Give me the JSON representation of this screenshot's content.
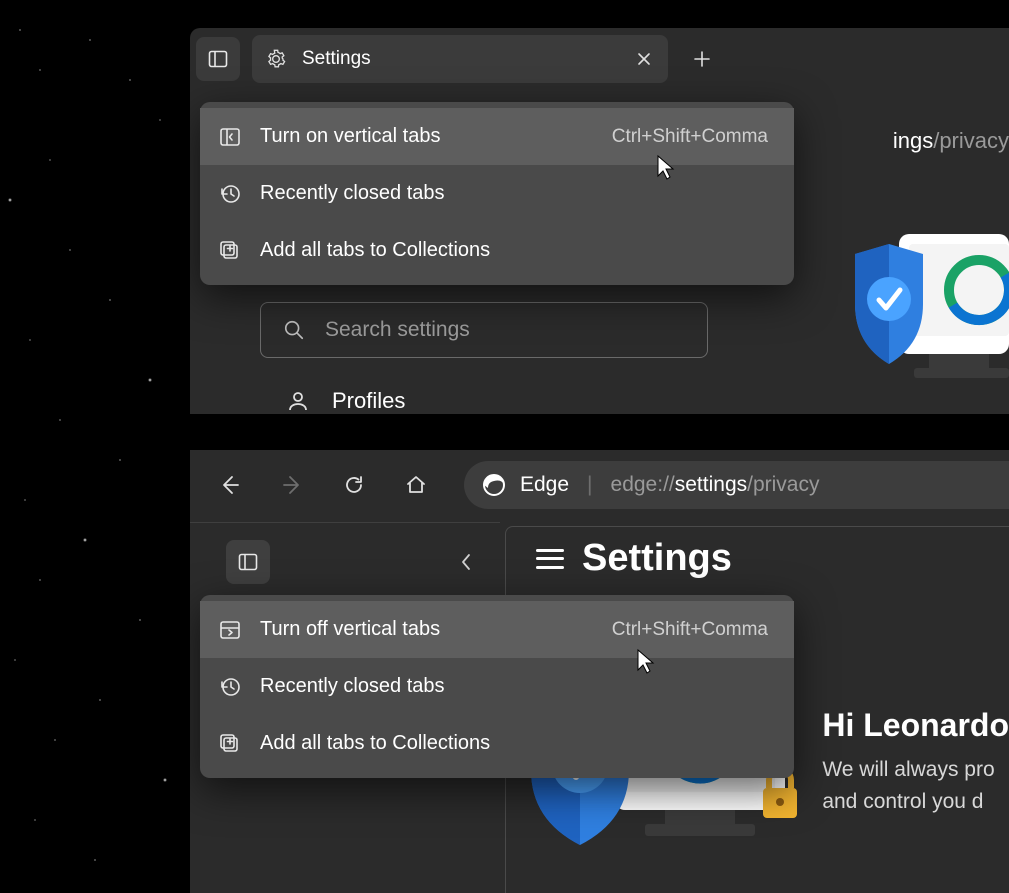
{
  "top": {
    "tab_title": "Settings",
    "url_part1": "ings",
    "url_part2": "/privacy",
    "menu": {
      "item1_label": "Turn on vertical tabs",
      "item1_shortcut": "Ctrl+Shift+Comma",
      "item2_label": "Recently closed tabs",
      "item3_label": "Add all tabs to Collections"
    },
    "search_placeholder": "Search settings",
    "profiles_label": "Profiles"
  },
  "bottom": {
    "addr_brand": "Edge",
    "addr_url_dim1": "edge://",
    "addr_url_bright": "settings",
    "addr_url_dim2": "/privacy",
    "settings_heading": "Settings",
    "menu": {
      "item1_label": "Turn off vertical tabs",
      "item1_shortcut": "Ctrl+Shift+Comma",
      "item2_label": "Recently closed tabs",
      "item3_label": "Add all tabs to Collections"
    },
    "greeting_heading": "Hi Leonardo",
    "greeting_line1": "We will always pro",
    "greeting_line2": "and control you d"
  }
}
